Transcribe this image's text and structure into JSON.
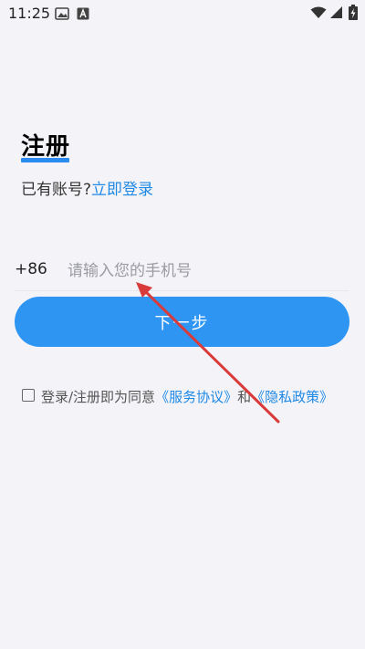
{
  "status_bar": {
    "time": "11:25",
    "icons": [
      "gallery-icon",
      "font-icon",
      "wifi-icon",
      "signal-icon",
      "battery-charging-icon"
    ]
  },
  "register": {
    "title": "注册",
    "has_account_text": "已有账号?",
    "login_link": "立即登录"
  },
  "phone": {
    "country_code": "+86",
    "placeholder": "请输入您的手机号",
    "value": ""
  },
  "next_button": {
    "label": "下一步"
  },
  "agreement": {
    "prefix": "登录/注册即为同意",
    "service_link": "《服务协议》",
    "and": "和",
    "privacy_link": "《隐私政策》",
    "checked": false
  },
  "colors": {
    "accent": "#2e95f3",
    "link": "#1e88e5",
    "background": "#f4f4f8",
    "annotation_arrow": "#d93a3a"
  }
}
